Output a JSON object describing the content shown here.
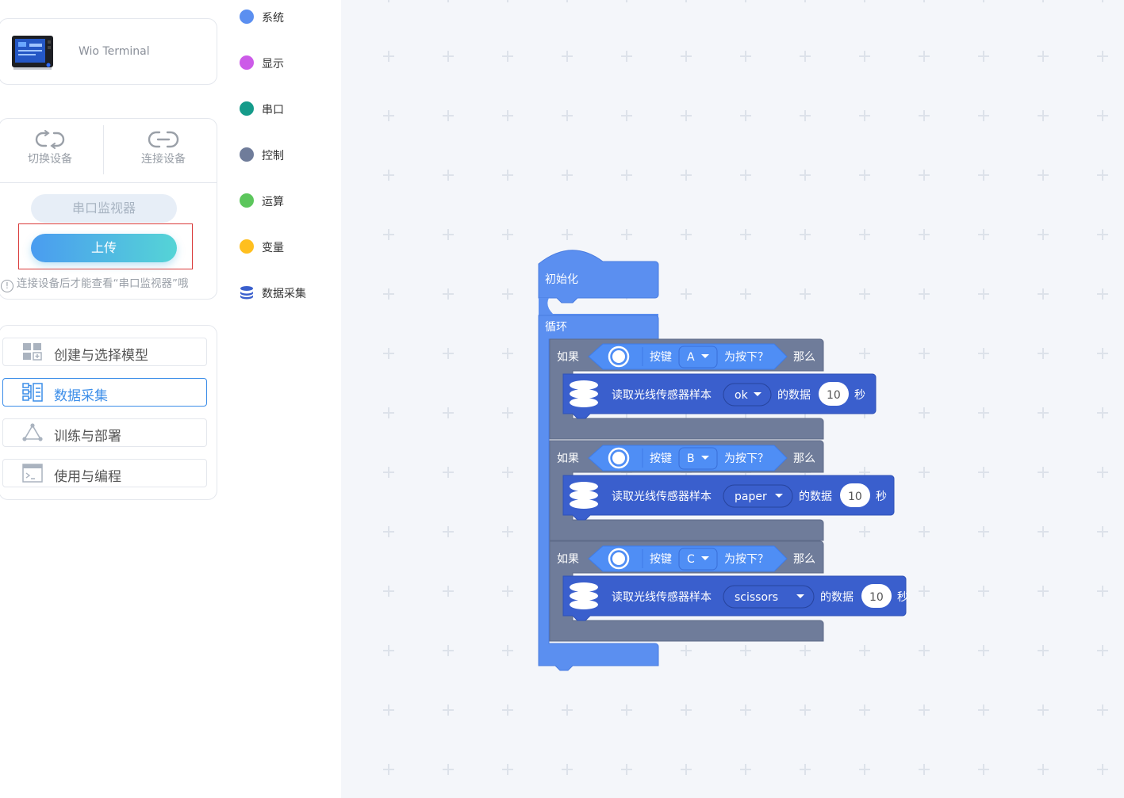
{
  "device": {
    "name": "Wio Terminal"
  },
  "connection": {
    "switch_label": "切换设备",
    "connect_label": "连接设备",
    "serial_monitor_label": "串口监视器",
    "upload_label": "上传",
    "hint": "连接设备后才能查看“串口监视器”哦"
  },
  "steps": [
    {
      "label": "创建与选择模型",
      "icon": "model-grid-icon"
    },
    {
      "label": "数据采集",
      "icon": "data-collect-icon",
      "active": true
    },
    {
      "label": "训练与部署",
      "icon": "triangle-nodes-icon"
    },
    {
      "label": "使用与编程",
      "icon": "terminal-window-icon"
    }
  ],
  "categories": [
    {
      "label": "系统",
      "color": "#5b8ff0"
    },
    {
      "label": "显示",
      "color": "#cc5be8"
    },
    {
      "label": "串口",
      "color": "#159b8a"
    },
    {
      "label": "控制",
      "color": "#6f7c9a"
    },
    {
      "label": "运算",
      "color": "#5cc65c"
    },
    {
      "label": "变量",
      "color": "#ffbf1f"
    },
    {
      "label": "数据采集",
      "color": "#3a5fcd",
      "icon": "database-icon"
    }
  ],
  "blocks": {
    "setup_label": "初始化",
    "loop_label": "循环",
    "if_label": "如果",
    "then_label": "那么",
    "button_label": "按键",
    "pressed_label": "为按下？",
    "read_label": "读取光线传感器样本",
    "data_label": "的数据",
    "seconds_label": "秒",
    "colors": {
      "event": "#5b8ff0",
      "control": "#6f7c9a",
      "data": "#3a5fcd",
      "sensor": "#4f8ef5"
    },
    "conditions": [
      {
        "button": "A",
        "sample": "ok",
        "seconds": "10"
      },
      {
        "button": "B",
        "sample": "paper",
        "seconds": "10"
      },
      {
        "button": "C",
        "sample": "scissors",
        "seconds": "10"
      }
    ]
  }
}
